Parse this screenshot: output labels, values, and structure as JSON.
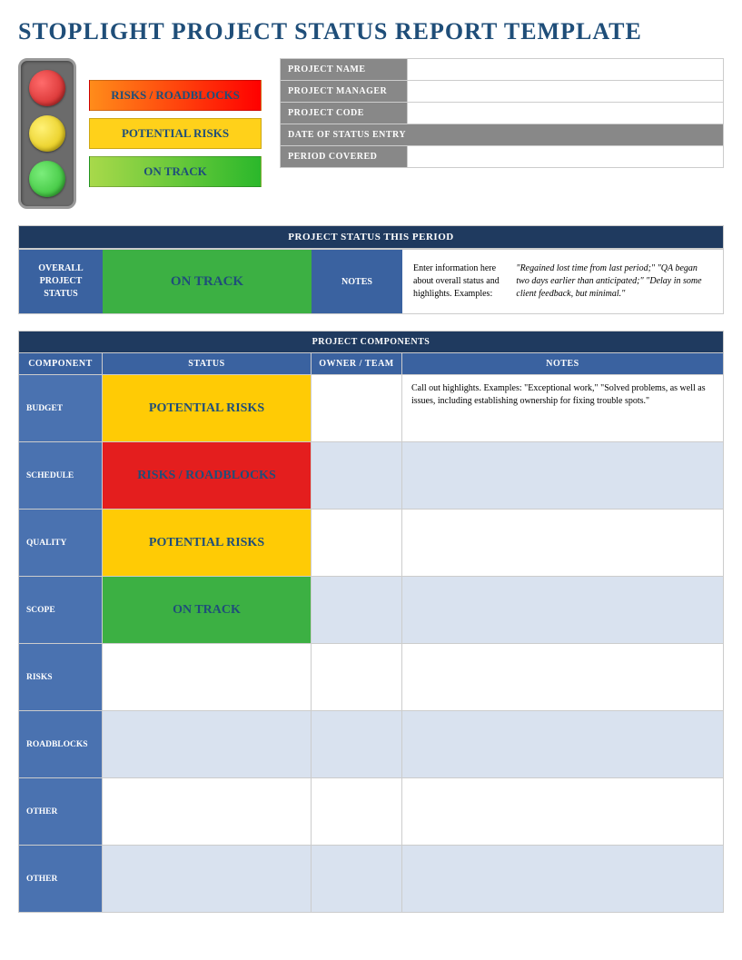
{
  "title": "STOPLIGHT PROJECT STATUS REPORT TEMPLATE",
  "legend": {
    "red": "RISKS / ROADBLOCKS",
    "yellow": "POTENTIAL RISKS",
    "green": "ON TRACK"
  },
  "info": {
    "project_name_label": "PROJECT NAME",
    "project_name": "",
    "project_manager_label": "PROJECT MANAGER",
    "project_manager": "",
    "project_code_label": "PROJECT CODE",
    "project_code": "",
    "date_label": "DATE OF STATUS ENTRY",
    "date": "",
    "period_label": "PERIOD COVERED",
    "period": ""
  },
  "status_period": {
    "header": "PROJECT STATUS THIS PERIOD",
    "overall_label": "OVERALL PROJECT STATUS",
    "overall_status": "ON TRACK",
    "notes_label": "NOTES",
    "notes_intro": "Enter information here about overall status and highlights. Examples: ",
    "notes_example": "\"Regained lost time from last period;\" \"QA began two days earlier than anticipated;\" \"Delay in some client feedback, but minimal.\""
  },
  "components": {
    "header": "PROJECT COMPONENTS",
    "cols": {
      "component": "COMPONENT",
      "status": "STATUS",
      "owner": "OWNER / TEAM",
      "notes": "NOTES"
    },
    "rows": [
      {
        "label": "BUDGET",
        "status": "POTENTIAL RISKS",
        "status_class": "status-yellow",
        "owner": "",
        "notes": "Call out highlights. Examples: \"Exceptional work,\" \"Solved problems, as well as issues, including establishing ownership for fixing trouble spots.\""
      },
      {
        "label": "SCHEDULE",
        "status": "RISKS / ROADBLOCKS",
        "status_class": "status-red",
        "owner": "",
        "notes": ""
      },
      {
        "label": "QUALITY",
        "status": "POTENTIAL RISKS",
        "status_class": "status-yellow",
        "owner": "",
        "notes": ""
      },
      {
        "label": "SCOPE",
        "status": "ON TRACK",
        "status_class": "status-green",
        "owner": "",
        "notes": ""
      },
      {
        "label": "RISKS",
        "status": "",
        "status_class": "",
        "owner": "",
        "notes": ""
      },
      {
        "label": "ROADBLOCKS",
        "status": "",
        "status_class": "",
        "owner": "",
        "notes": ""
      },
      {
        "label": "OTHER",
        "status": "",
        "status_class": "",
        "owner": "",
        "notes": ""
      },
      {
        "label": "OTHER",
        "status": "",
        "status_class": "",
        "owner": "",
        "notes": ""
      }
    ]
  }
}
